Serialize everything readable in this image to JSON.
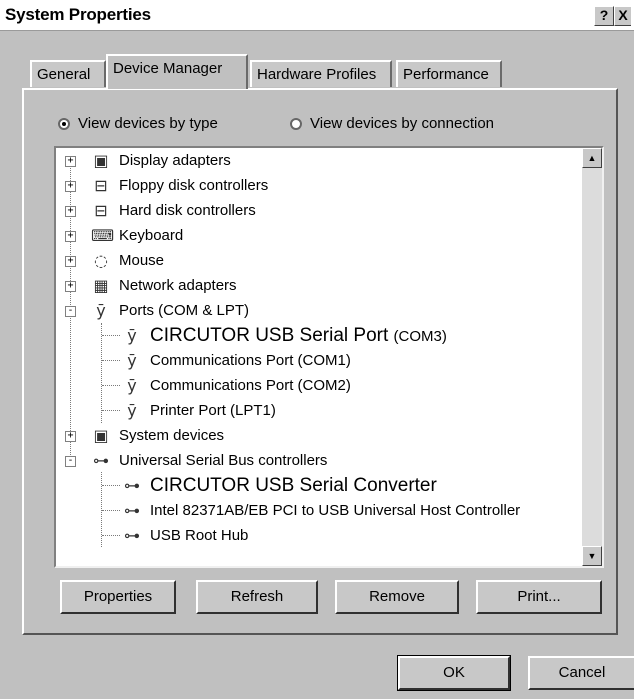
{
  "window": {
    "title": "System Properties",
    "help_label": "?",
    "close_label": "X"
  },
  "tabs": [
    {
      "label": "General"
    },
    {
      "label": "Device Manager"
    },
    {
      "label": "Hardware Profiles"
    },
    {
      "label": "Performance"
    }
  ],
  "active_tab": "Device Manager",
  "view_options": {
    "by_type": {
      "label": "View devices by type",
      "checked": true
    },
    "by_connection": {
      "label": "View devices by connection",
      "checked": false
    }
  },
  "device_tree": [
    {
      "label": "Display adapters",
      "icon": "monitor-icon",
      "expander": "+"
    },
    {
      "label": "Floppy disk controllers",
      "icon": "disk-controller-icon",
      "expander": "+"
    },
    {
      "label": "Hard disk controllers",
      "icon": "disk-controller-icon",
      "expander": "+"
    },
    {
      "label": "Keyboard",
      "icon": "keyboard-icon",
      "expander": "+"
    },
    {
      "label": "Mouse",
      "icon": "mouse-icon",
      "expander": "+"
    },
    {
      "label": "Network adapters",
      "icon": "network-adapter-icon",
      "expander": "+"
    },
    {
      "label": "Ports (COM & LPT)",
      "icon": "port-connector-icon",
      "expander": "-"
    },
    {
      "label": "CIRCUTOR USB Serial Port",
      "suffix": "(COM3)",
      "icon": "port-connector-icon",
      "child": true,
      "emphasis": true
    },
    {
      "label": "Communications Port (COM1)",
      "icon": "port-connector-icon",
      "child": true
    },
    {
      "label": "Communications Port (COM2)",
      "icon": "port-connector-icon",
      "child": true
    },
    {
      "label": "Printer Port (LPT1)",
      "icon": "port-connector-icon",
      "child": true
    },
    {
      "label": "System devices",
      "icon": "computer-icon",
      "expander": "+"
    },
    {
      "label": "Universal Serial Bus controllers",
      "icon": "usb-icon",
      "expander": "-"
    },
    {
      "label": "CIRCUTOR USB Serial Converter",
      "icon": "usb-icon",
      "child": true,
      "emphasis": true
    },
    {
      "label": "Intel 82371AB/EB PCI to USB Universal Host Controller",
      "icon": "usb-icon",
      "child": true
    },
    {
      "label": "USB Root Hub",
      "icon": "usb-icon",
      "child": true
    }
  ],
  "scrollbar": {
    "up_glyph": "▲",
    "down_glyph": "▼"
  },
  "actions": {
    "properties": "Properties",
    "refresh": "Refresh",
    "remove": "Remove",
    "print": "Print..."
  },
  "dialog_buttons": {
    "ok": "OK",
    "cancel": "Cancel"
  }
}
